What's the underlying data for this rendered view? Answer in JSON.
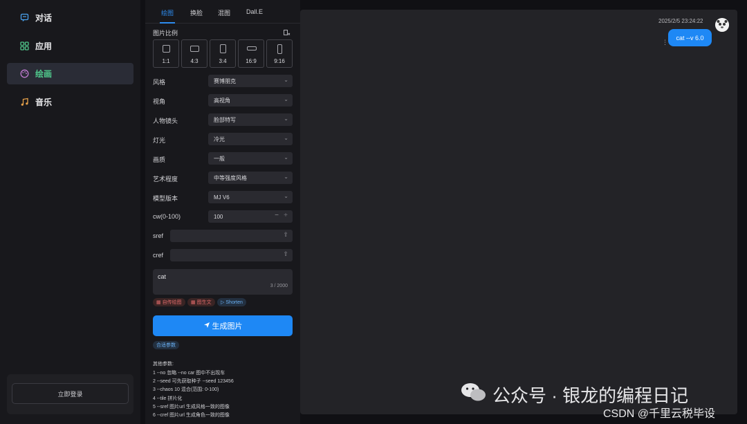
{
  "nav": {
    "items": [
      {
        "label": "对话",
        "icon": "chat-icon"
      },
      {
        "label": "应用",
        "icon": "apps-grid-icon"
      },
      {
        "label": "绘画",
        "icon": "palette-icon"
      },
      {
        "label": "音乐",
        "icon": "music-note-icon"
      }
    ],
    "active_index": 2,
    "login_label": "立即登录"
  },
  "panel": {
    "tabs": [
      {
        "label": "绘图"
      },
      {
        "label": "换脸"
      },
      {
        "label": "混图"
      },
      {
        "label": "Dall.E"
      }
    ],
    "active_tab": 0,
    "ratio_label": "图片比例",
    "ratios": [
      "1:1",
      "4:3",
      "3:4",
      "16:9",
      "9:16"
    ],
    "fields": [
      {
        "label": "风格",
        "value": "赛博朋克"
      },
      {
        "label": "视角",
        "value": "高视角"
      },
      {
        "label": "人物镜头",
        "value": "脸部特写"
      },
      {
        "label": "灯光",
        "value": "冷光"
      },
      {
        "label": "画质",
        "value": "一般"
      },
      {
        "label": "艺术程度",
        "value": "中等强度风格"
      },
      {
        "label": "模型版本",
        "value": "MJ V6"
      }
    ],
    "cw": {
      "label": "cw(0-100)",
      "value": "100"
    },
    "sref": {
      "label": "sref"
    },
    "cref": {
      "label": "cref"
    },
    "prompt": {
      "text": "cat",
      "count": "3 / 2000"
    },
    "chips": [
      "自传绘图",
      "图生文",
      "Shorten"
    ],
    "generate_label": "生成图片",
    "combo_label": "合适参数",
    "notes": [
      "其他参数:",
      "1 --no 忽略 --no car 图中不出现车",
      "2 --seed 可先获取种子 --seed 123456",
      "3 --chaos 10 混合(范围: 0-100)",
      "4 --tile 拼片化",
      "5 --sref 图片url 生成风格一致的图像",
      "6 --cref 图片url 生成角色一致的图像"
    ]
  },
  "chat": {
    "timestamp": "2025/2/5 23:24:22",
    "message": "cat --v 6.0"
  },
  "watermark": {
    "line1": "公众号 · 银龙的编程日记",
    "line2": "CSDN @千里云税毕设"
  },
  "colors": {
    "accent_blue": "#1e88f5",
    "active_green": "#4fc58a",
    "chip_red": "#e36b6b"
  }
}
